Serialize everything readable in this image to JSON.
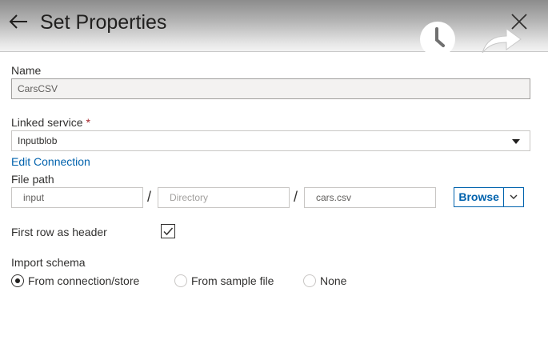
{
  "header": {
    "title": "Set Properties",
    "icons": [
      "back-arrow-icon",
      "clock-icon",
      "redo-arrow-icon",
      "close-icon"
    ]
  },
  "form": {
    "name": {
      "label": "Name",
      "value": "CarsCSV"
    },
    "linked_service": {
      "label": "Linked service",
      "required_marker": "*",
      "value": "Inputblob"
    },
    "edit_connection_link": "Edit Connection",
    "file_path": {
      "label": "File path",
      "container": "input",
      "directory_placeholder": "Directory",
      "file": "cars.csv",
      "separator": "/",
      "browse_label": "Browse"
    },
    "first_row_header": {
      "label": "First row as header",
      "checked": true
    },
    "import_schema": {
      "label": "Import schema",
      "options": [
        {
          "label": "From connection/store",
          "selected": true
        },
        {
          "label": "From sample file",
          "selected": false
        },
        {
          "label": "None",
          "selected": false
        }
      ]
    }
  },
  "colors": {
    "link": "#0062ad",
    "required": "#a4262c",
    "header_gradient_top": "#8c8c8c"
  }
}
